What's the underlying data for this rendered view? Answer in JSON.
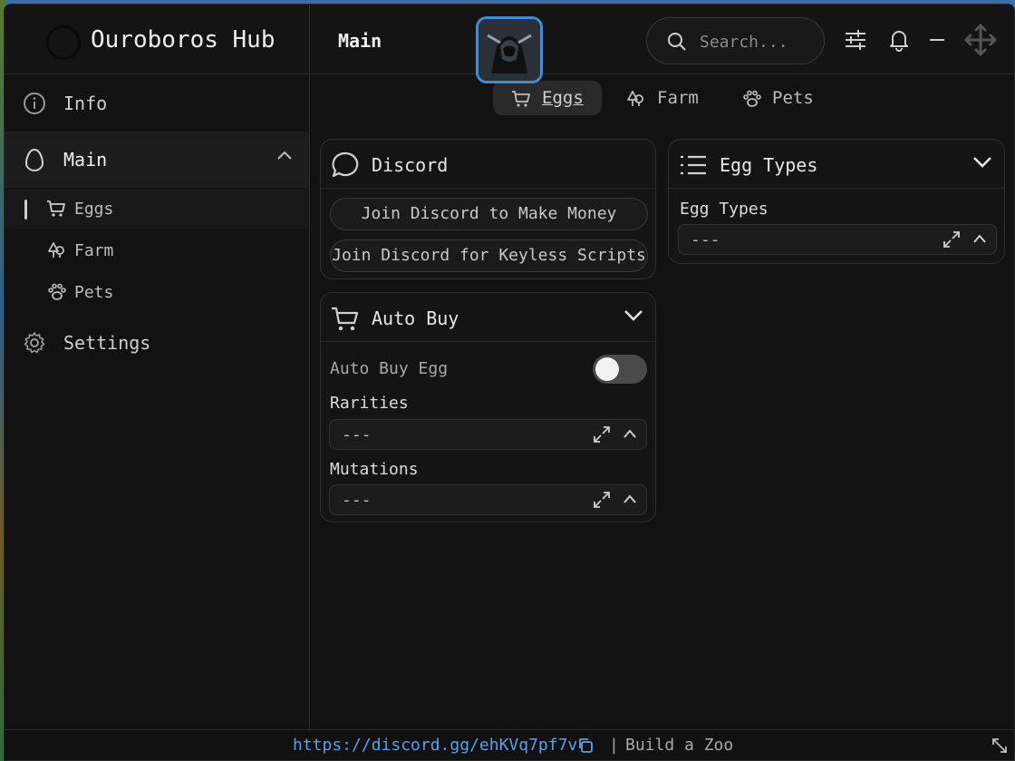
{
  "app": {
    "title": "Ouroboros Hub",
    "page_title": "Main",
    "search_placeholder": "Search...",
    "accent_color": "#3b8de0"
  },
  "sidebar": {
    "items": [
      {
        "label": "Info",
        "icon": "info-icon"
      },
      {
        "label": "Main",
        "icon": "egg-icon",
        "expanded": true
      },
      {
        "label": "Settings",
        "icon": "gear-icon"
      }
    ],
    "sub_items": [
      {
        "label": "Eggs",
        "icon": "cart-icon",
        "selected": true
      },
      {
        "label": "Farm",
        "icon": "tree-icon"
      },
      {
        "label": "Pets",
        "icon": "paw-icon"
      }
    ]
  },
  "tabs": [
    {
      "label": "Eggs",
      "icon": "cart-icon",
      "active": true
    },
    {
      "label": "Farm",
      "icon": "tree-icon"
    },
    {
      "label": "Pets",
      "icon": "paw-icon"
    }
  ],
  "discord_panel": {
    "title": "Discord",
    "buttons": [
      "Join Discord to Make Money",
      "Join Discord for Keyless Scripts"
    ]
  },
  "auto_buy_panel": {
    "title": "Auto Buy",
    "toggle_label": "Auto Buy Egg",
    "toggle_on": false,
    "rarities_label": "Rarities",
    "rarities_value": "---",
    "mutations_label": "Mutations",
    "mutations_value": "---"
  },
  "egg_types_panel": {
    "title": "Egg Types",
    "field_label": "Egg Types",
    "field_value": "---"
  },
  "footer": {
    "link": "https://discord.gg/ehKVq7pf7v",
    "separator": "|",
    "game": "Build a Zoo"
  }
}
